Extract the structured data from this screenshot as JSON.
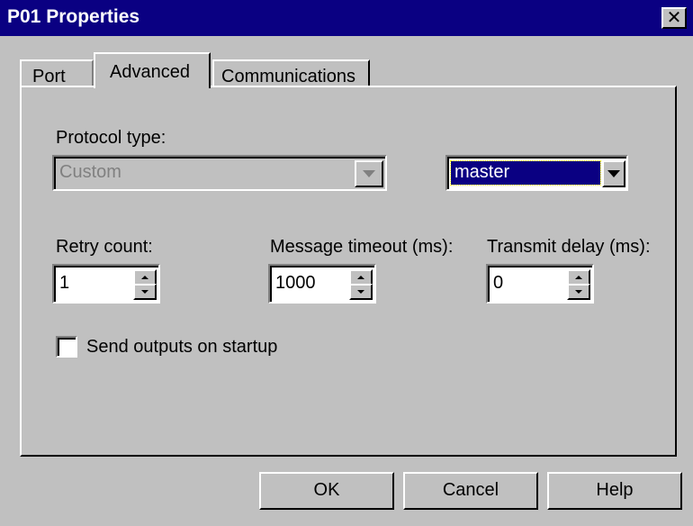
{
  "window": {
    "title": "P01 Properties",
    "close_glyph": "✕"
  },
  "tabs": [
    {
      "label": "Port",
      "active": false
    },
    {
      "label": "Advanced",
      "active": true
    },
    {
      "label": "Communications",
      "active": false
    }
  ],
  "protocol": {
    "label": "Protocol type:",
    "value": "Custom",
    "disabled": true
  },
  "mode": {
    "value": "master"
  },
  "retry": {
    "label": "Retry count:",
    "value": "1"
  },
  "timeout": {
    "label": "Message timeout (ms):",
    "value": "1000"
  },
  "delay": {
    "label": "Transmit delay (ms):",
    "value": "0"
  },
  "startup": {
    "label": "Send outputs on startup",
    "checked": false
  },
  "buttons": {
    "ok": "OK",
    "cancel": "Cancel",
    "help": "Help"
  },
  "colors": {
    "face": "#c0c0c0",
    "title_bg": "#0a0082",
    "selection": "#0a0082",
    "disabled_text": "#808080"
  }
}
